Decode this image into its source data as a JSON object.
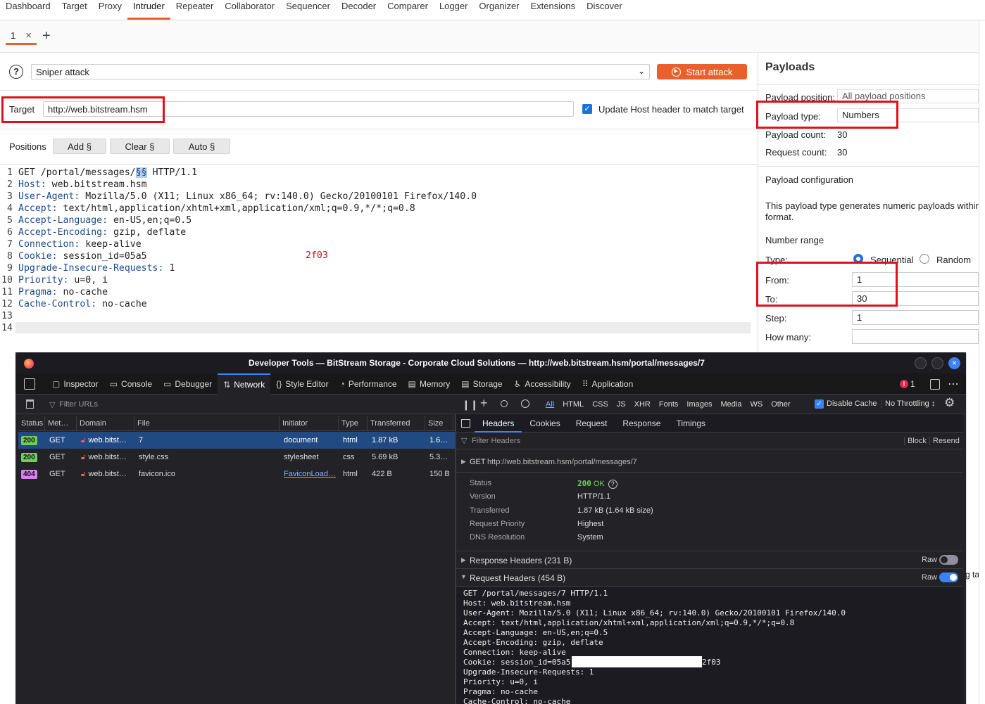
{
  "nav": [
    "Dashboard",
    "Target",
    "Proxy",
    "Intruder",
    "Repeater",
    "Collaborator",
    "Sequencer",
    "Decoder",
    "Comparer",
    "Logger",
    "Organizer",
    "Extensions",
    "Discover"
  ],
  "nav_active": 3,
  "tab": {
    "label": "1",
    "close": "×",
    "add": "+"
  },
  "attack": {
    "help": "?",
    "type": "Sniper attack",
    "start": "Start attack"
  },
  "target": {
    "label": "Target",
    "url": "http://web.bitstream.hsm",
    "update_label": "Update Host header to match target"
  },
  "positions": {
    "label": "Positions",
    "add": "Add §",
    "clear": "Clear §",
    "auto": "Auto §"
  },
  "request_lines": [
    {
      "n": "1",
      "k": "",
      "v": "GET /portal/messages/§§ HTTP/1.1"
    },
    {
      "n": "2",
      "k": "Host:",
      "v": " web.bitstream.hsm"
    },
    {
      "n": "3",
      "k": "User-Agent:",
      "v": " Mozilla/5.0 (X11; Linux x86_64; rv:140.0) Gecko/20100101 Firefox/140.0"
    },
    {
      "n": "4",
      "k": "Accept:",
      "v": " text/html,application/xhtml+xml,application/xml;q=0.9,*/*;q=0.8"
    },
    {
      "n": "5",
      "k": "Accept-Language:",
      "v": " en-US,en;q=0.5"
    },
    {
      "n": "6",
      "k": "Accept-Encoding:",
      "v": " gzip, deflate"
    },
    {
      "n": "7",
      "k": "Connection:",
      "v": " keep-alive"
    },
    {
      "n": "8",
      "k": "Cookie:",
      "v": " session_id=05a5"
    },
    {
      "n": "9",
      "k": "Upgrade-Insecure-Requests:",
      "v": " 1"
    },
    {
      "n": "10",
      "k": "Priority:",
      "v": " u=0, i"
    },
    {
      "n": "11",
      "k": "Pragma:",
      "v": " no-cache"
    },
    {
      "n": "12",
      "k": "Cache-Control:",
      "v": " no-cache"
    },
    {
      "n": "13",
      "k": "",
      "v": ""
    },
    {
      "n": "14",
      "k": "",
      "v": ""
    }
  ],
  "cookie_tail": "2f03",
  "payloads": {
    "title": "Payloads",
    "position_label": "Payload position:",
    "position_value": "All payload positions",
    "type_label": "Payload type:",
    "type_value": "Numbers",
    "count_label": "Payload count:",
    "count_value": "30",
    "req_label": "Request count:",
    "req_value": "30",
    "config_title": "Payload configuration",
    "config_desc1": "This payload type generates numeric payloads within",
    "config_desc2": "format.",
    "range_title": "Number range",
    "type_row": "Type:",
    "seq": "Sequential",
    "rand": "Random",
    "from_label": "From:",
    "from_value": "1",
    "to_label": "To:",
    "to_value": "30",
    "step_label": "Step:",
    "step_value": "1",
    "howmany_label": "How many:",
    "howmany_value": ""
  },
  "devtools": {
    "title": "Developer Tools — BitStream Storage - Corporate Cloud Solutions — http://web.bitstream.hsm/portal/messages/7",
    "tools": [
      "Inspector",
      "Console",
      "Debugger",
      "Network",
      "Style Editor",
      "Performance",
      "Memory",
      "Storage",
      "Accessibility",
      "Application"
    ],
    "error_count": "1",
    "filter_placeholder": "Filter URLs",
    "type_filters": [
      "All",
      "HTML",
      "CSS",
      "JS",
      "XHR",
      "Fonts",
      "Images",
      "Media",
      "WS",
      "Other"
    ],
    "disable_cache": "Disable Cache",
    "throttling": "No Throttling",
    "columns": [
      "Status",
      "Met…",
      "Domain",
      "File",
      "Initiator",
      "Type",
      "Transferred",
      "Size"
    ],
    "rows": [
      {
        "status": "200",
        "method": "GET",
        "domain": "web.bitst…",
        "file": "7",
        "initiator": "document",
        "type": "html",
        "transferred": "1.87 kB",
        "size": "1.6…"
      },
      {
        "status": "200",
        "method": "GET",
        "domain": "web.bitst…",
        "file": "style.css",
        "initiator": "stylesheet",
        "type": "css",
        "transferred": "5.69 kB",
        "size": "5.3…"
      },
      {
        "status": "404",
        "method": "GET",
        "domain": "web.bitst…",
        "file": "favicon.ico",
        "initiator": "FaviconLoad…",
        "type": "html",
        "transferred": "422 B",
        "size": "150 B"
      }
    ],
    "detail_tabs": [
      "Headers",
      "Cookies",
      "Request",
      "Response",
      "Timings"
    ],
    "filter_headers": "Filter Headers",
    "block": "Block",
    "resend": "Resend",
    "get_line": "GET",
    "get_url": "http://web.bitstream.hsm/portal/messages/7",
    "summary": [
      {
        "k": "Status",
        "v": "200",
        "v2": "OK"
      },
      {
        "k": "Version",
        "v": "HTTP/1.1"
      },
      {
        "k": "Transferred",
        "v": "1.87 kB (1.64 kB size)"
      },
      {
        "k": "Request Priority",
        "v": "Highest"
      },
      {
        "k": "DNS Resolution",
        "v": "System"
      }
    ],
    "resp_headers": "Response Headers (231 B)",
    "req_headers": "Request Headers (454 B)",
    "raw": "Raw",
    "raw_lines": [
      "GET /portal/messages/7 HTTP/1.1",
      "Host: web.bitstream.hsm",
      "User-Agent: Mozilla/5.0 (X11; Linux x86_64; rv:140.0) Gecko/20100101 Firefox/140.0",
      "Accept: text/html,application/xhtml+xml,application/xml;q=0.9,*/*;q=0.8",
      "Accept-Language: en-US,en;q=0.5",
      "Accept-Encoding: gzip, deflate",
      "Connection: keep-alive",
      "Cookie: session_id=05a5",
      "Upgrade-Insecure-Requests: 1",
      "Priority: u=0, i",
      "Pragma: no-cache",
      "Cache-Control: no-cache"
    ],
    "raw_cookie_tail": "2f03"
  },
  "side_fragment": "g ta",
  "colors": {
    "accent": "#e8612c",
    "highlight": "#e0101a",
    "selected_row": "#214a82",
    "ok_badge": "#6ece5b",
    "err_badge": "#d97ff2"
  }
}
